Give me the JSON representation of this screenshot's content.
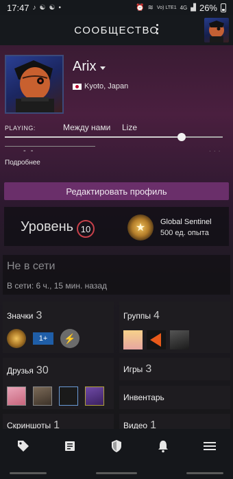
{
  "status_bar": {
    "time": "17:47",
    "carrier": "Vo) LTE1",
    "network": "4G",
    "battery": "26%"
  },
  "app_bar": {
    "title": "СООБЩЕСТВО"
  },
  "profile": {
    "name": "Arix",
    "location": "Kyoto, Japan",
    "playing_label": "PLAYING:",
    "now_playing": {
      "title": "Между нами",
      "artist": "Lize",
      "progress_fraction": 0.81
    },
    "placeholder_time": "- -",
    "more_label": "Подробнее",
    "edit_button": "Редактировать профиль"
  },
  "level": {
    "label": "Уровень",
    "value": "10",
    "badge_name": "Global Sentinel",
    "badge_xp": "500 ед. опыта"
  },
  "status": {
    "state": "Не в сети",
    "last_seen": "В сети: 6 ч., 15 мин. назад"
  },
  "sections": {
    "badges": {
      "label": "Значки",
      "count": "3",
      "plus_text": "1+"
    },
    "groups": {
      "label": "Группы",
      "count": "4"
    },
    "friends": {
      "label": "Друзья",
      "count": "30"
    },
    "games": {
      "label": "Игры",
      "count": "3"
    },
    "inventory": {
      "label": "Инвентарь"
    },
    "screenshots": {
      "label": "Скриншоты",
      "count": "1"
    },
    "videos": {
      "label": "Видео",
      "count": "1"
    }
  },
  "bottom_nav": [
    "tag-icon",
    "news-icon",
    "shield-icon",
    "bell-icon",
    "menu-icon"
  ],
  "colors": {
    "accent_button": "#6a2f6a",
    "level_ring": "#c7404a"
  }
}
